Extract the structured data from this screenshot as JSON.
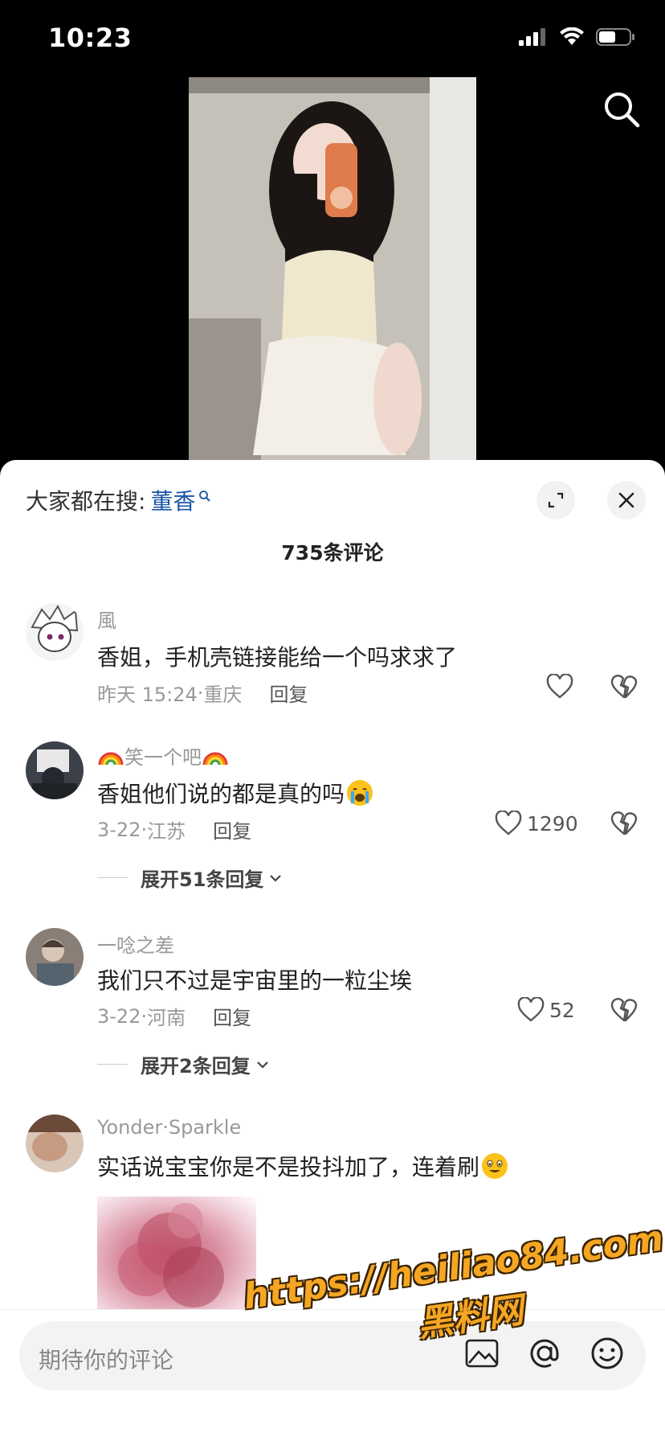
{
  "status_bar": {
    "time": "10:23"
  },
  "search_bar": {
    "prefix": "大家都在搜:",
    "keyword": "董香"
  },
  "comments_count": "735条评论",
  "comments": [
    {
      "user": "風",
      "text": "香姐，手机壳链接能给一个吗求求了",
      "date": "昨天 15:24",
      "location": "重庆",
      "reply_label": "回复",
      "likes": ""
    },
    {
      "user": "笑一个吧",
      "text": "香姐他们说的都是真的吗",
      "date": "3-22",
      "location": "江苏",
      "reply_label": "回复",
      "likes": "1290",
      "expand": "展开51条回复"
    },
    {
      "user": "一唸之差",
      "text": "我们只不过是宇宙里的一粒尘埃",
      "date": "3-22",
      "location": "河南",
      "reply_label": "回复",
      "likes": "52",
      "expand": "展开2条回复"
    },
    {
      "user": "Yonder·Sparkle",
      "text": "实话说宝宝你是不是投抖加了，连着刷"
    }
  ],
  "input": {
    "placeholder": "期待你的评论"
  },
  "watermark": {
    "url": "https://heiliao84.com",
    "site": "黑料网"
  },
  "colors": {
    "keyword": "#1a56a6",
    "watermark": "#f5a623"
  }
}
